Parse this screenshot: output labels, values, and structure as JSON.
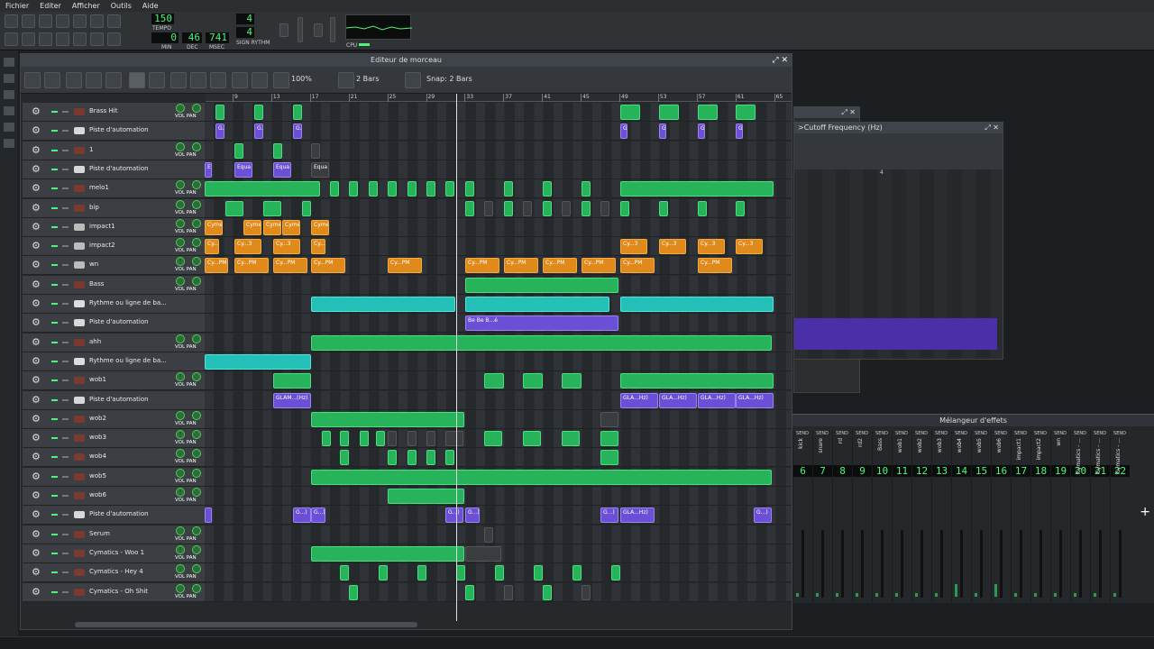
{
  "menu": [
    "Fichier",
    "Editer",
    "Afficher",
    "Outils",
    "Aide"
  ],
  "transport": {
    "tempo": "150",
    "tempo_label": "TEMPO",
    "min": "0",
    "dec": "46",
    "msec": "741",
    "min_label": "MIN",
    "dec_label": "DEC",
    "msec_label": "MSEC",
    "sig_top": "4",
    "sig_bottom": "4",
    "sig_label": "SIGN RYTHM",
    "cpu_label": "CPU"
  },
  "song_editor": {
    "title": "Editeur de morceau",
    "zoom": "100%",
    "bars": "2 Bars",
    "snap": "Snap: 2 Bars"
  },
  "ruler_ticks": [
    "9",
    "13",
    "17",
    "21",
    "25",
    "29",
    "33",
    "37",
    "41",
    "45",
    "49",
    "53",
    "57",
    "61",
    "65"
  ],
  "tracks": [
    {
      "name": "Brass Hit",
      "type": "instrument"
    },
    {
      "name": "Piste d'automation",
      "type": "automation"
    },
    {
      "name": "1",
      "type": "instrument"
    },
    {
      "name": "Piste d'automation",
      "type": "automation"
    },
    {
      "name": "melo1",
      "type": "instrument"
    },
    {
      "name": "bip",
      "type": "instrument"
    },
    {
      "name": "impact1",
      "type": "sample"
    },
    {
      "name": "impact2",
      "type": "sample"
    },
    {
      "name": "wn",
      "type": "sample"
    },
    {
      "name": "Bass",
      "type": "instrument"
    },
    {
      "name": "Rythme ou ligne de ba...",
      "type": "beat"
    },
    {
      "name": "Piste d'automation",
      "type": "automation"
    },
    {
      "name": "ahh",
      "type": "instrument"
    },
    {
      "name": "Rythme ou ligne de ba...",
      "type": "beat"
    },
    {
      "name": "wob1",
      "type": "instrument"
    },
    {
      "name": "Piste d'automation",
      "type": "automation"
    },
    {
      "name": "wob2",
      "type": "instrument"
    },
    {
      "name": "wob3",
      "type": "instrument"
    },
    {
      "name": "wob4",
      "type": "instrument"
    },
    {
      "name": "wob5",
      "type": "instrument"
    },
    {
      "name": "wob6",
      "type": "instrument"
    },
    {
      "name": "Piste d'automation",
      "type": "automation"
    },
    {
      "name": "Serum",
      "type": "instrument"
    },
    {
      "name": "Cymatics - Woo 1",
      "type": "instrument"
    },
    {
      "name": "Cymatics - Hey 4",
      "type": "instrument"
    },
    {
      "name": "Cymatics - Oh Shit",
      "type": "instrument"
    }
  ],
  "labels": {
    "vol_pan": "VOL PAN",
    "clip_equ": "Equa",
    "clip_cyme": "Cyme",
    "clip_cypm": "Cy...PM",
    "clip_cy3": "Cy...3",
    "clip_glam": "GLAM...(Hz)",
    "clip_glahz": "GLA...Hz)",
    "clip_be": "Be Be B...é",
    "clip_g": "G...)"
  },
  "automation_window": {
    "title": ">Cutoff Frequency (Hz)",
    "tick_4": "4"
  },
  "mixer": {
    "title": "Mélangeur d'effets",
    "send": "SEND",
    "channels": [
      {
        "num": "6",
        "name": "kick"
      },
      {
        "num": "7",
        "name": "snare"
      },
      {
        "num": "8",
        "name": "rd"
      },
      {
        "num": "9",
        "name": "rd2"
      },
      {
        "num": "10",
        "name": "Bass"
      },
      {
        "num": "11",
        "name": "wob1"
      },
      {
        "num": "12",
        "name": "wob2"
      },
      {
        "num": "13",
        "name": "wob3"
      },
      {
        "num": "14",
        "name": "wob4"
      },
      {
        "num": "15",
        "name": "wob5"
      },
      {
        "num": "16",
        "name": "wob6"
      },
      {
        "num": "17",
        "name": "impact1"
      },
      {
        "num": "18",
        "name": "impact2"
      },
      {
        "num": "19",
        "name": "wn"
      },
      {
        "num": "20",
        "name": "Cymatics - ..."
      },
      {
        "num": "21",
        "name": "Cymatics - ..."
      },
      {
        "num": "22",
        "name": "Cymatics - ..."
      }
    ]
  }
}
